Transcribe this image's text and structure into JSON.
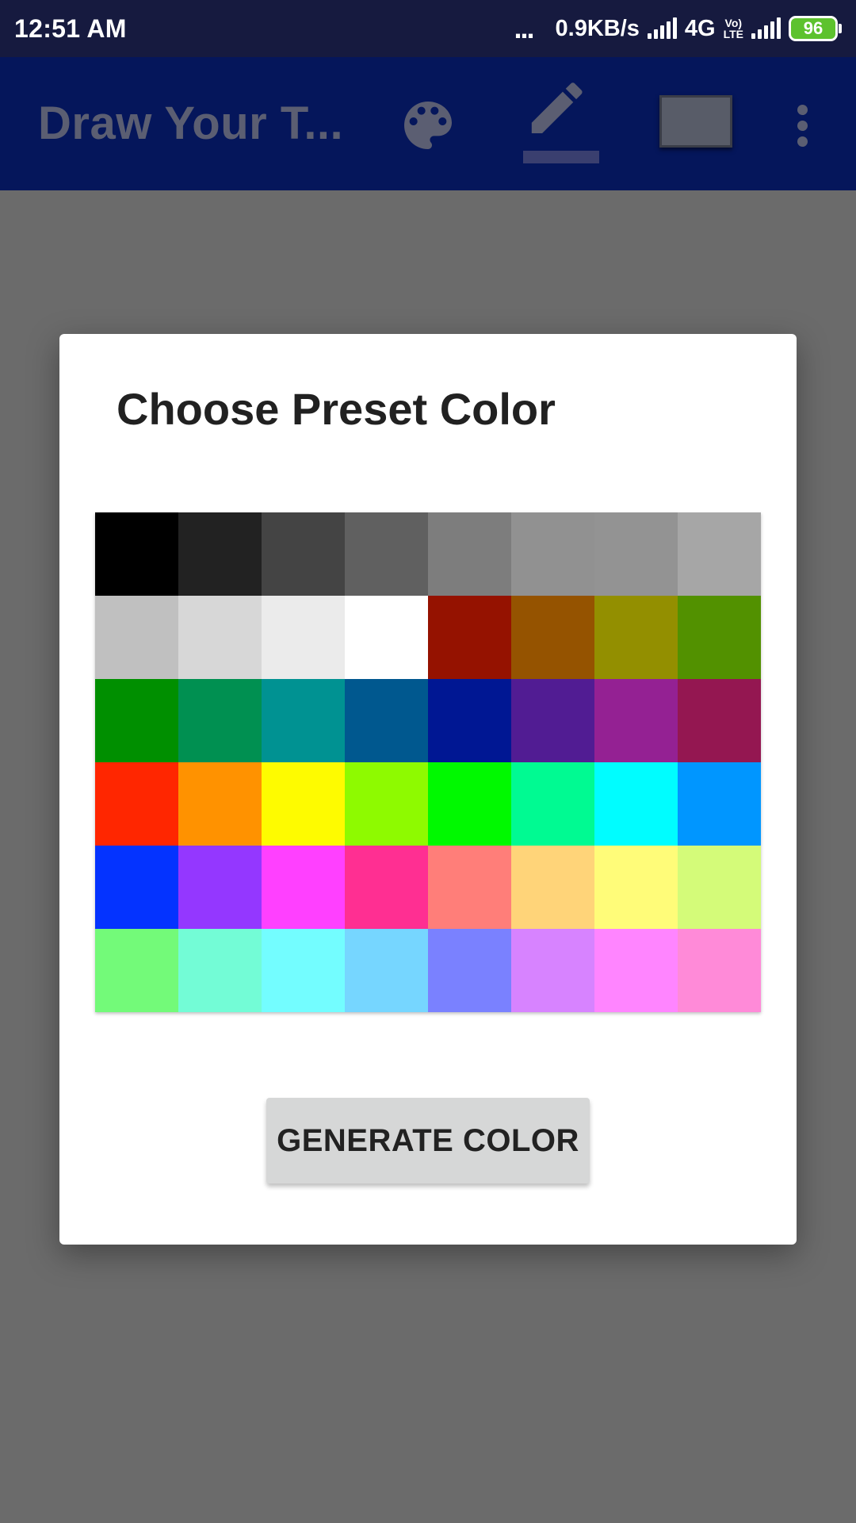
{
  "status_bar": {
    "time": "12:51 AM",
    "dots": "...",
    "speed": "0.9KB/s",
    "network": "4G",
    "volte_top": "Vo)",
    "volte_bottom": "LTE",
    "battery": "96"
  },
  "app_bar": {
    "title": "Draw Your T...",
    "icons": [
      "palette-icon",
      "pencil-icon",
      "rectangle-icon",
      "more-vert-icon"
    ]
  },
  "dialog": {
    "title": "Choose Preset Color",
    "swatches": [
      "#000000",
      "#222222",
      "#444444",
      "#606060",
      "#7d7d7d",
      "#919191",
      "#939393",
      "#a6a6a6",
      "#c0c0c0",
      "#d7d7d7",
      "#ebebeb",
      "#ffffff",
      "#951200",
      "#955300",
      "#938f00",
      "#529100",
      "#008f00",
      "#009051",
      "#009292",
      "#00588f",
      "#001793",
      "#511c93",
      "#942193",
      "#941751",
      "#ff2600",
      "#ff9200",
      "#fefb00",
      "#8efa00",
      "#00f900",
      "#00fa92",
      "#00fdff",
      "#0096ff",
      "#0433ff",
      "#9437ff",
      "#ff40ff",
      "#ff2f92",
      "#ff7e79",
      "#ffd479",
      "#fffc79",
      "#d4fb79",
      "#73fa79",
      "#73fcd6",
      "#73fdff",
      "#76d6ff",
      "#7a81ff",
      "#d783ff",
      "#ff85ff",
      "#ff8ad8"
    ],
    "generate_button": "GENERATE COLOR"
  }
}
